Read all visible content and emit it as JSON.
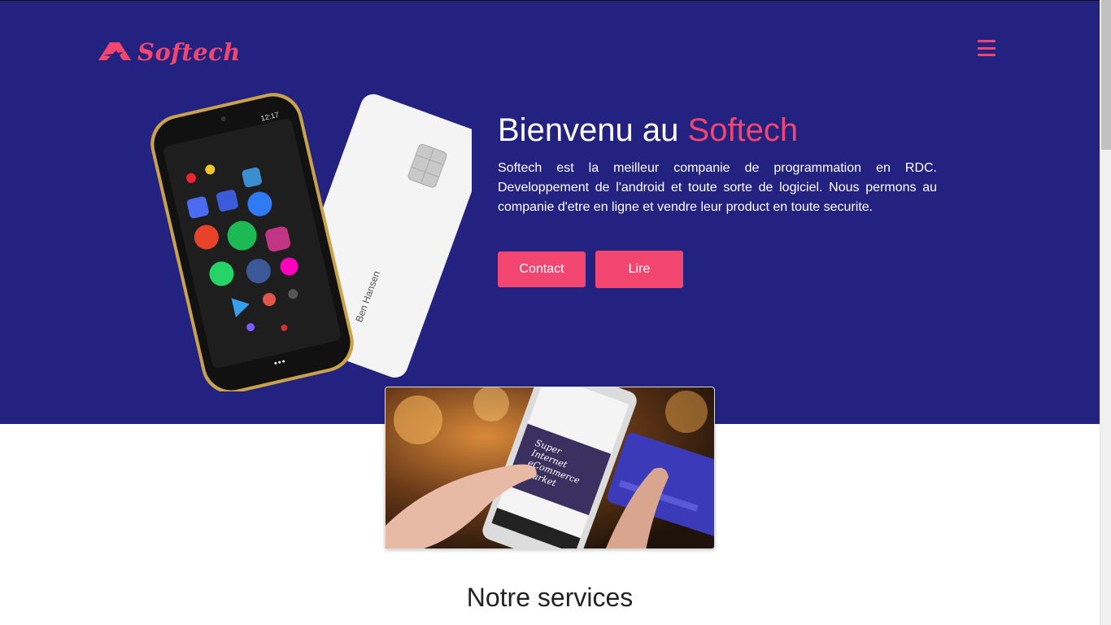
{
  "brand": {
    "name": "Softech",
    "accent_color": "#f2456f",
    "hero_bg": "#242280"
  },
  "nav": {
    "menu_icon": "hamburger-icon"
  },
  "hero": {
    "title_prefix": "Bienvenu au ",
    "title_accent": "Softech",
    "text": "Softech est la meilleur companie de programmation en RDC. Developpement de l'android et toute sorte de logiciel. Nous permons au companie d'etre en ligne et vendre leur product en toute securite.",
    "buttons": {
      "contact": "Contact",
      "read": "Lire"
    },
    "card_name": "Ben Hansen",
    "phone_time": "12:17"
  },
  "feature_image": {
    "screen_text": [
      "Super",
      "Internet",
      "eCommerce",
      "Market"
    ]
  },
  "services": {
    "title": "Notre services"
  }
}
